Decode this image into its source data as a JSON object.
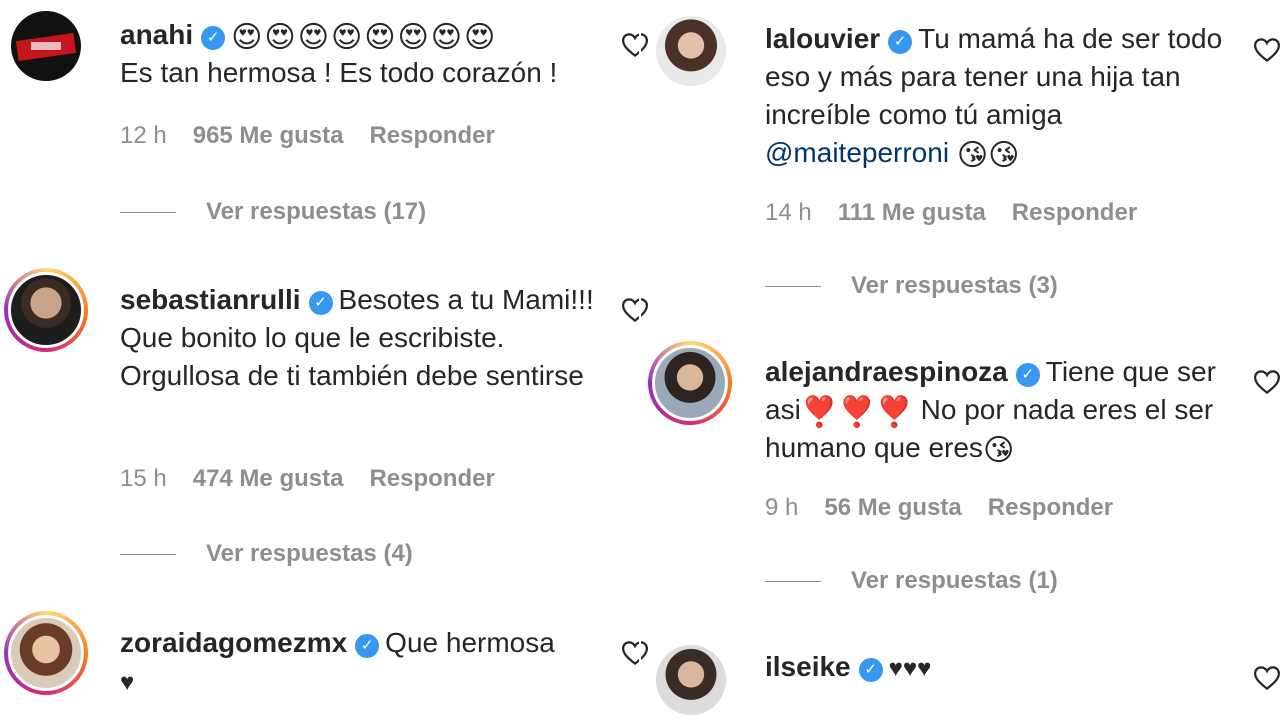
{
  "comments": [
    {
      "username": "anahi",
      "emoji_run": "😍😍😍😍😍😍😍😍",
      "text": "Es tan hermosa ! Es todo corazón !",
      "time": "12 h",
      "likes": "965 Me gusta",
      "reply": "Responder",
      "view_replies": "Ver respuestas (17)"
    },
    {
      "username": "sebastianrulli",
      "text": "Besotes a tu Mami!!! Que bonito lo que le escribiste. Orgullosa de ti también debe sentirse",
      "time": "15 h",
      "likes": "474 Me gusta",
      "reply": "Responder",
      "view_replies": "Ver respuestas (4)"
    },
    {
      "username": "zoraidagomezmx",
      "text": "Que hermosa",
      "trailing": "♥"
    },
    {
      "username": "lalouvier",
      "text": "Tu mamá ha de ser todo eso y más para tener una hija tan increíble como tú amiga",
      "mention": "@maiteperroni",
      "emoji_after": "😘😘",
      "time": "14 h",
      "likes": "111 Me gusta",
      "reply": "Responder",
      "view_replies": "Ver respuestas (3)"
    },
    {
      "username": "alejandraespinoza",
      "text_1": "Tiene que ser asi",
      "emoji_mid": "❣️❣️❣️",
      "text_2": "No por nada eres el ser humano que eres",
      "emoji_end": "😘",
      "time": "9 h",
      "likes": "56 Me gusta",
      "reply": "Responder",
      "view_replies": "Ver respuestas (1)"
    },
    {
      "username": "ilseike",
      "text": "♥♥♥"
    }
  ],
  "icons": {
    "verified": "verified-badge-icon",
    "like": "heart-outline-icon"
  },
  "colors": {
    "text": "#262626",
    "meta": "#8e8e8e",
    "mention": "#00376b",
    "verified": "#3897f0"
  }
}
